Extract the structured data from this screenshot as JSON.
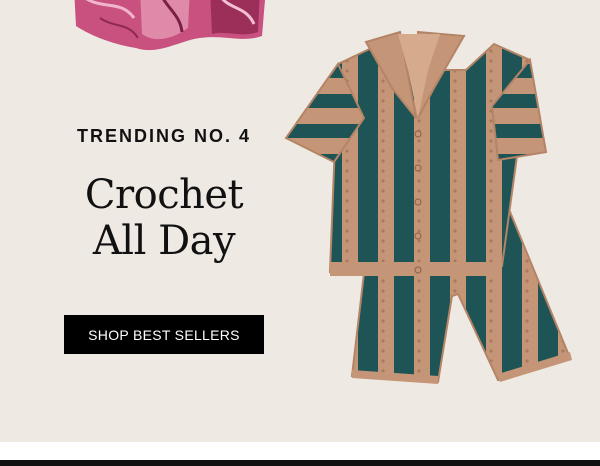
{
  "promo": {
    "eyebrow": "TRENDING NO. 4",
    "headline_line1": "Crochet",
    "headline_line2": "All Day",
    "cta_label": "SHOP BEST SELLERS"
  },
  "colors": {
    "background": "#eeeae3",
    "tan": "#c49677",
    "teal": "#1f5456",
    "pink": "#c8517f",
    "button": "#000000"
  }
}
